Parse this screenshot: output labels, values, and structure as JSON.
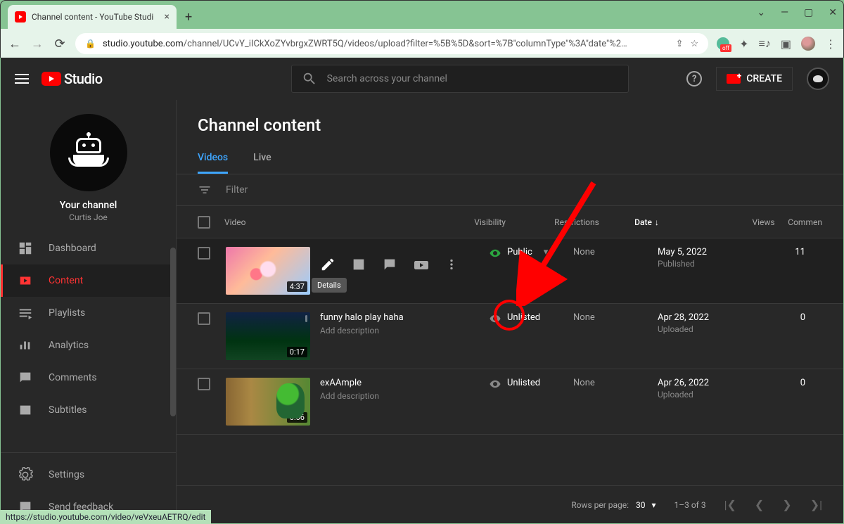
{
  "browser": {
    "tab_title": "Channel content - YouTube Studi",
    "url_host": "studio.youtube.com",
    "url_path": "/channel/UCvY_iICkXoZYvbrgxZWRT5Q/videos/upload?filter=%5B%5D&sort=%7B\"columnType\"%3A\"date\"%2…",
    "ext_badge": "off"
  },
  "header": {
    "logo": "Studio",
    "search_placeholder": "Search across your channel",
    "create_label": "CREATE"
  },
  "sidebar": {
    "channel_title": "Your channel",
    "channel_name": "Curtis Joe",
    "items": [
      {
        "label": "Dashboard"
      },
      {
        "label": "Content"
      },
      {
        "label": "Playlists"
      },
      {
        "label": "Analytics"
      },
      {
        "label": "Comments"
      },
      {
        "label": "Subtitles"
      }
    ],
    "bottom": [
      {
        "label": "Settings"
      },
      {
        "label": "Send feedback"
      }
    ]
  },
  "page": {
    "title": "Channel content",
    "tabs": [
      {
        "label": "Videos",
        "active": true
      },
      {
        "label": "Live",
        "active": false
      }
    ],
    "filter_placeholder": "Filter",
    "columns": {
      "video": "Video",
      "visibility": "Visibility",
      "restrictions": "Restrictions",
      "date": "Date",
      "views": "Views",
      "comments": "Commen"
    },
    "hover_tooltip": "Details",
    "rows": [
      {
        "duration": "4:37",
        "title": "",
        "desc": "",
        "visibility": "Public",
        "vis_type": "public",
        "restrictions": "None",
        "date": "May 5, 2022",
        "date_sub": "Published",
        "views": "11"
      },
      {
        "duration": "0:17",
        "title": "funny halo play haha",
        "desc": "Add description",
        "visibility": "Unlisted",
        "vis_type": "unlisted",
        "restrictions": "None",
        "date": "Apr 28, 2022",
        "date_sub": "Uploaded",
        "views": "0"
      },
      {
        "duration": "0:06",
        "title": "exAAmple",
        "desc": "Add description",
        "visibility": "Unlisted",
        "vis_type": "unlisted",
        "restrictions": "None",
        "date": "Apr 26, 2022",
        "date_sub": "Uploaded",
        "views": "0"
      }
    ],
    "footer": {
      "rows_label": "Rows per page:",
      "rows_value": "30",
      "range": "1–3 of 3"
    }
  },
  "status_url": "https://studio.youtube.com/video/veVxeuAETRQ/edit"
}
